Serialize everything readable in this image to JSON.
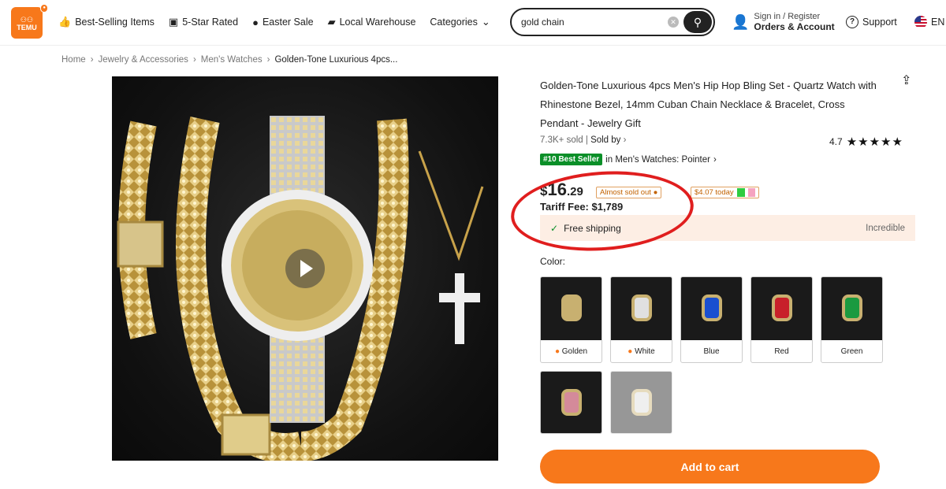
{
  "header": {
    "logo_text": "TEMU",
    "nav": [
      {
        "label": "Best-Selling Items",
        "icon": "thumbs-up-icon"
      },
      {
        "label": "5-Star Rated",
        "icon": "star-box-icon"
      },
      {
        "label": "Easter Sale",
        "icon": "egg-icon"
      },
      {
        "label": "Local Warehouse",
        "icon": "truck-icon"
      },
      {
        "label": "Categories",
        "icon": "chevron-down-icon"
      }
    ],
    "search_value": "gold chain",
    "account_line1": "Sign in / Register",
    "account_line2": "Orders & Account",
    "support": "Support",
    "lang": "EN"
  },
  "breadcrumb": [
    "Home",
    "Jewelry & Accessories",
    "Men's Watches",
    "Golden-Tone Luxurious 4pcs..."
  ],
  "product": {
    "title": "Golden-Tone Luxurious 4pcs Men's Hip Hop Bling Set - Quartz Watch with Rhinestone Bezel, 14mm Cuban Chain Necklace & Bracelet, Cross Pendant - Jewelry Gift",
    "sold": "7.3K+ sold",
    "sold_by": "Sold by",
    "rating": "4.7",
    "stars": "★★★★★",
    "best_seller": "#10 Best Seller",
    "best_category": "in Men's Watches: Pointer",
    "price_dollar": "$",
    "price_int": "16",
    "price_cents": ".29",
    "almost_sold_out": "Almost sold out",
    "today_text": "$4.07 today",
    "tariff": "Tariff Fee: $1,789",
    "free_shipping": "Free shipping",
    "incredible": "Incredible",
    "color_label": "Color:",
    "colors": [
      {
        "name": "Golden",
        "hot": true,
        "face": "#c8b070"
      },
      {
        "name": "White",
        "hot": true,
        "face": "#e0e0e0"
      },
      {
        "name": "Blue",
        "hot": false,
        "face": "#1a4fd0"
      },
      {
        "name": "Red",
        "hot": false,
        "face": "#c8202a"
      },
      {
        "name": "Green",
        "hot": false,
        "face": "#1a9a40"
      }
    ],
    "add_to_cart": "Add to cart"
  }
}
